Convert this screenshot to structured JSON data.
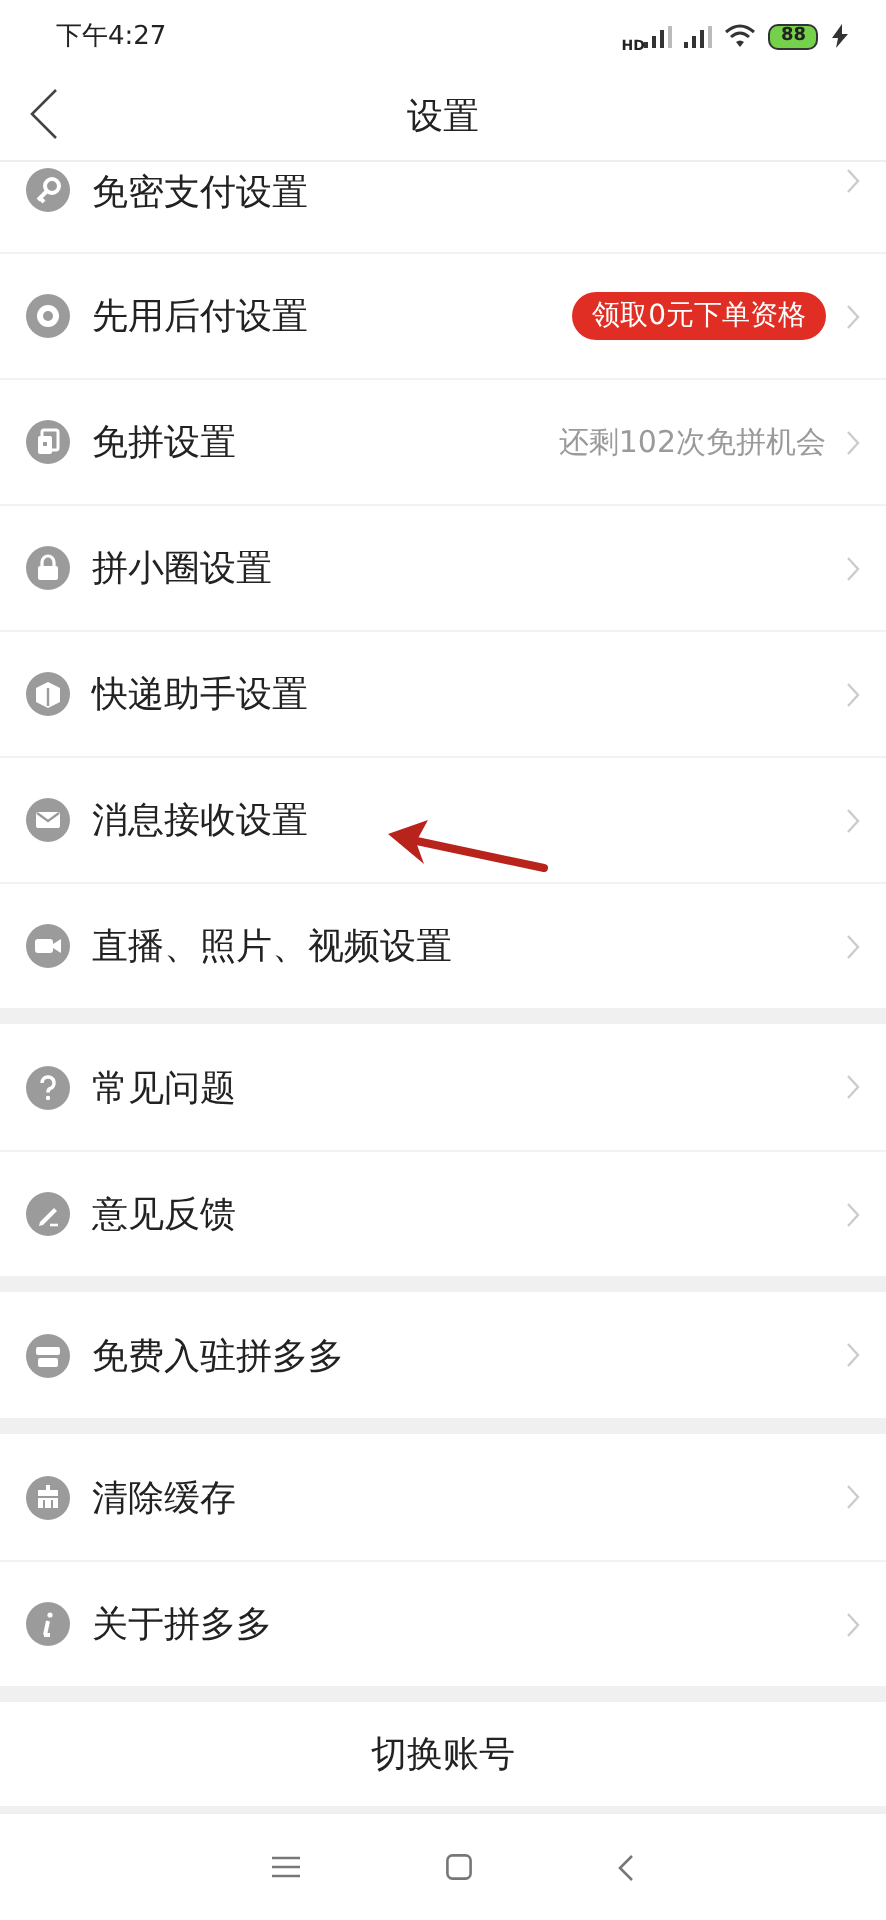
{
  "status_bar": {
    "time": "下午4:27",
    "signal_label": "HD",
    "battery": "88"
  },
  "nav_bar": {
    "title": "设置"
  },
  "sections": [
    {
      "items": [
        {
          "label": "免密支付设置",
          "cut": true
        },
        {
          "label": "先用后付设置",
          "badge": "领取0元下单资格"
        },
        {
          "label": "免拼设置",
          "note": "还剩102次免拼机会"
        },
        {
          "label": "拼小圈设置"
        },
        {
          "label": "快递助手设置"
        },
        {
          "label": "消息接收设置"
        },
        {
          "label": "直播、照片、视频设置"
        }
      ]
    },
    {
      "items": [
        {
          "label": "常见问题"
        },
        {
          "label": "意见反馈"
        }
      ]
    },
    {
      "items": [
        {
          "label": "免费入驻拼多多"
        }
      ]
    },
    {
      "items": [
        {
          "label": "清除缓存"
        },
        {
          "label": "关于拼多多"
        }
      ]
    }
  ],
  "switch_account": "切换账号"
}
